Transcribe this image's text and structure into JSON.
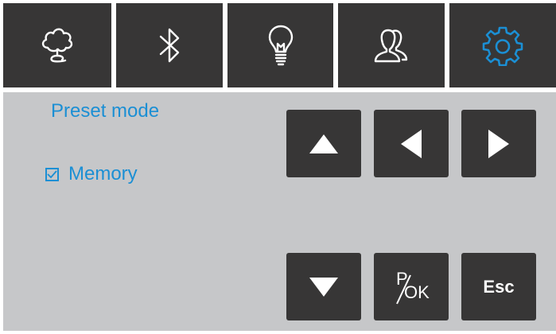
{
  "tabs": [
    {
      "icon": "tree-icon"
    },
    {
      "icon": "bluetooth-icon"
    },
    {
      "icon": "lightbulb-icon"
    },
    {
      "icon": "users-icon"
    },
    {
      "icon": "gear-icon",
      "selected": true
    }
  ],
  "panel": {
    "title": "Preset mode",
    "memory": {
      "label": "Memory",
      "checked": true
    }
  },
  "keys": {
    "up": {
      "icon": "arrow-up-icon"
    },
    "left": {
      "icon": "arrow-left-icon"
    },
    "right": {
      "icon": "arrow-right-icon"
    },
    "down": {
      "icon": "arrow-down-icon"
    },
    "pok": {
      "top": "P",
      "bottom": "OK"
    },
    "esc": {
      "label": "Esc"
    }
  },
  "colors": {
    "accent": "#1b8fd4",
    "tab_bg": "#373636",
    "panel_bg": "#c6c7c9",
    "icon_white": "#ffffff"
  }
}
